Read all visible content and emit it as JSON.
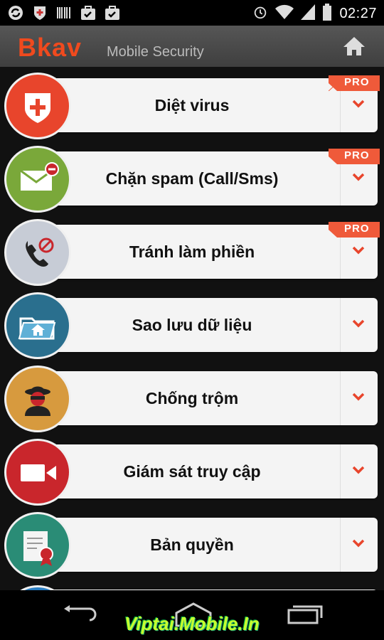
{
  "statusbar": {
    "time": "02:27"
  },
  "appbar": {
    "brand": "Bkav",
    "subtitle": "Mobile Security"
  },
  "items": [
    {
      "label": "Diệt virus",
      "pro": "PRO",
      "color": "#e8452c",
      "icon": "shield-icon"
    },
    {
      "label": "Chặn spam (Call/Sms)",
      "pro": "PRO",
      "color": "#7aa83a",
      "icon": "mail-block-icon"
    },
    {
      "label": "Tránh làm phiền",
      "pro": "PRO",
      "color": "#c7ccd6",
      "icon": "phone-block-icon"
    },
    {
      "label": "Sao lưu dữ liệu",
      "pro": "",
      "color": "#2a6f8e",
      "icon": "folder-home-icon"
    },
    {
      "label": "Chống trộm",
      "pro": "",
      "color": "#d79a3e",
      "icon": "thief-icon"
    },
    {
      "label": "Giám sát truy cập",
      "pro": "",
      "color": "#c9262c",
      "icon": "camera-icon"
    },
    {
      "label": "Bản quyền",
      "pro": "",
      "color": "#2a8c76",
      "icon": "certificate-icon"
    }
  ],
  "navbar": {
    "watermark": "Viptai.Mobile.In"
  }
}
